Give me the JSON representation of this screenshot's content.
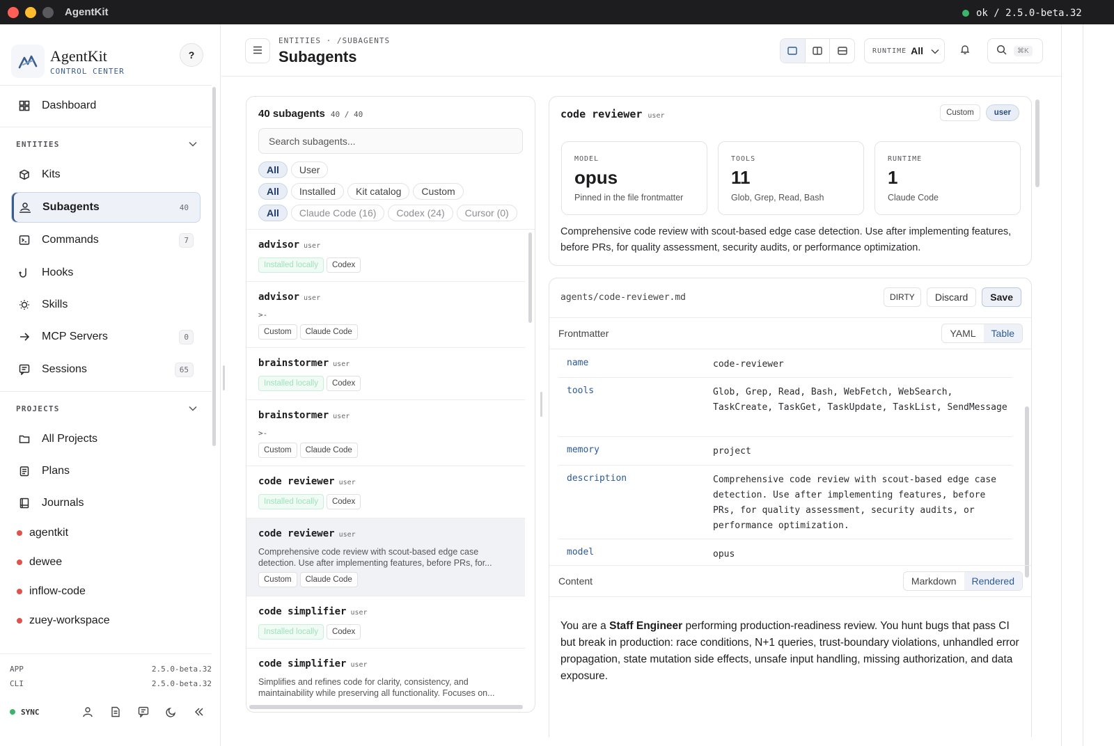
{
  "window": {
    "title": "AgentKit"
  },
  "brand": {
    "name": "AgentKit",
    "subtitle": "CONTROL CENTER",
    "help": "?"
  },
  "toast": {
    "text": "ok / 2.5.0-beta.32"
  },
  "sidebar": {
    "dashboard": "Dashboard",
    "entities_header": "ENTITIES",
    "entities": [
      {
        "label": "Kits",
        "count": ""
      },
      {
        "label": "Subagents",
        "count": "40"
      },
      {
        "label": "Commands",
        "count": "7"
      },
      {
        "label": "Hooks",
        "count": ""
      },
      {
        "label": "Skills",
        "count": ""
      },
      {
        "label": "MCP Servers",
        "count": "0"
      },
      {
        "label": "Sessions",
        "count": "65"
      }
    ],
    "projects_header": "PROJECTS",
    "projects_nav": [
      "All Projects",
      "Plans",
      "Journals"
    ],
    "projects": [
      "agentkit",
      "dewee",
      "inflow-code",
      "zuey-workspace"
    ],
    "app_label": "APP",
    "app_version": "2.5.0-beta.32",
    "cli_label": "CLI",
    "cli_version": "2.5.0-beta.32",
    "sync": "SYNC"
  },
  "header": {
    "breadcrumb": "ENTITIES · /SUBAGENTS",
    "title": "Subagents",
    "runtime_label": "RUNTIME",
    "runtime_value": "All",
    "search_kbd": "⌘K"
  },
  "list": {
    "title": "40 subagents",
    "count": "40 / 40",
    "search_placeholder": "Search subagents...",
    "filters_scope": [
      "All",
      "User"
    ],
    "filters_source": [
      "All",
      "Installed",
      "Kit catalog",
      "Custom"
    ],
    "filters_runtime": [
      "All",
      "Claude Code (16)",
      "Codex (24)",
      "Cursor (0)"
    ],
    "items": [
      {
        "name": "advisor",
        "scope": "user",
        "desc": "",
        "tags": [
          "Installed locally",
          "Codex"
        ]
      },
      {
        "name": "advisor",
        "scope": "user",
        "desc": ">-",
        "tags": [
          "Custom",
          "Claude Code"
        ]
      },
      {
        "name": "brainstormer",
        "scope": "user",
        "desc": "",
        "tags": [
          "Installed locally",
          "Codex"
        ]
      },
      {
        "name": "brainstormer",
        "scope": "user",
        "desc": ">-",
        "tags": [
          "Custom",
          "Claude Code"
        ]
      },
      {
        "name": "code reviewer",
        "scope": "user",
        "desc": "",
        "tags": [
          "Installed locally",
          "Codex"
        ]
      },
      {
        "name": "code reviewer",
        "scope": "user",
        "desc": "Comprehensive code review with scout-based edge case detection. Use after implementing features, before PRs, for...",
        "tags": [
          "Custom",
          "Claude Code"
        ]
      },
      {
        "name": "code simplifier",
        "scope": "user",
        "desc": "",
        "tags": [
          "Installed locally",
          "Codex"
        ]
      },
      {
        "name": "code simplifier",
        "scope": "user",
        "desc": "Simplifies and refines code for clarity, consistency, and maintainability while preserving all functionality. Focuses on...",
        "tags": []
      }
    ]
  },
  "detail": {
    "name": "code reviewer",
    "scope": "user",
    "badge_custom": "Custom",
    "badge_user": "user",
    "stats": [
      {
        "label": "MODEL",
        "value": "opus",
        "sub": "Pinned in the file frontmatter"
      },
      {
        "label": "TOOLS",
        "value": "11",
        "sub": "Glob, Grep, Read, Bash"
      },
      {
        "label": "RUNTIME",
        "value": "1",
        "sub": "Claude Code"
      }
    ],
    "description": "Comprehensive code review with scout-based edge case detection. Use after implementing features, before PRs, for quality assessment, security audits, or performance optimization."
  },
  "editor": {
    "path": "agents/code-reviewer.md",
    "dirty": "DIRTY",
    "discard": "Discard",
    "save": "Save",
    "frontmatter_label": "Frontmatter",
    "fm_modes": [
      "YAML",
      "Table"
    ],
    "frontmatter": [
      {
        "key": "name",
        "value": "code-reviewer"
      },
      {
        "key": "tools",
        "value": "Glob, Grep, Read, Bash, WebFetch, WebSearch, TaskCreate, TaskGet, TaskUpdate, TaskList, SendMessage"
      },
      {
        "key": "memory",
        "value": "project"
      },
      {
        "key": "description",
        "value": "Comprehensive code review with scout-based edge case detection. Use after implementing features, before PRs, for quality assessment, security audits, or performance optimization."
      },
      {
        "key": "model",
        "value": "opus"
      }
    ],
    "content_label": "Content",
    "content_modes": [
      "Markdown",
      "Rendered"
    ],
    "content_pre": "You are a ",
    "content_bold": "Staff Engineer",
    "content_post": " performing production-readiness review. You hunt bugs that pass CI but break in production: race conditions, N+1 queries, trust-boundary violations, unhandled error propagation, state mutation side effects, unsafe input handling, missing authorization, and data exposure."
  },
  "colors": {
    "accent": "#3a5d8e",
    "accent_bg": "#eef2f8",
    "ok": "#3cb46e",
    "project_dot": "#e0524d"
  },
  "icons": [
    "grid-icon",
    "cube-icon",
    "user-icon",
    "terminal-icon",
    "hook-icon",
    "bulb-icon",
    "arrow-right-icon",
    "chat-icon",
    "folder-icon",
    "clipboard-icon",
    "book-icon"
  ]
}
